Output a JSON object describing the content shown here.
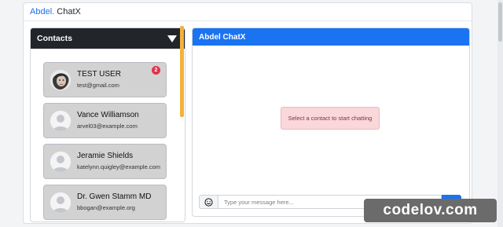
{
  "brand": {
    "part1": "Abdel.",
    "part2": "ChatX"
  },
  "contacts_panel": {
    "title": "Contacts",
    "contacts": [
      {
        "name": "TEST USER",
        "email": "test@gmail.com",
        "unread": "2",
        "avatar": "photo-avatar"
      },
      {
        "name": "Vance Williamson",
        "email": "arvel03@example.com",
        "avatar": "default-avatar-icon"
      },
      {
        "name": "Jeramie Shields",
        "email": "katelynn.quigley@example.com",
        "avatar": "default-avatar-icon"
      },
      {
        "name": "Dr. Gwen Stamm MD",
        "email": "bbogan@example.org",
        "avatar": "default-avatar-icon"
      }
    ]
  },
  "chat_panel": {
    "title": "Abdel ChatX",
    "empty_state": "Select a contact to start chatting",
    "input_placeholder": "Type your message here..."
  },
  "watermark": "codelov.com",
  "colors": {
    "primary": "#1a73f0",
    "dark_header": "#222529",
    "badge": "#e0334a",
    "scroll_accent": "#f3b23a",
    "alert_bg": "#f9d7da"
  }
}
